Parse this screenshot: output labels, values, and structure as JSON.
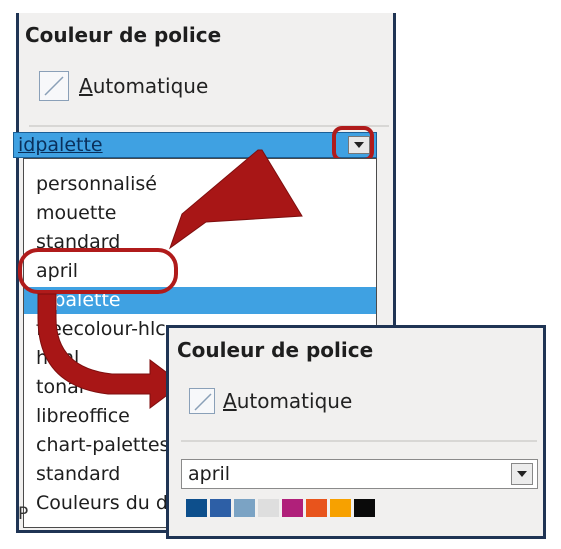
{
  "panel_back": {
    "title": "Couleur de police",
    "automatic_label_first": "A",
    "automatic_label_rest": "utomatique",
    "palette_selected": "idpalette",
    "palette_options": [
      "personnalisé",
      "mouette",
      "standard",
      "april",
      "idpalette",
      "freecolour-hlc",
      "html",
      "tonal",
      "libreoffice",
      "chart-palettes",
      "standard",
      "Couleurs du document"
    ],
    "highlighted_option": "idpalette",
    "bottom_fragment": "P"
  },
  "panel_front": {
    "title": "Couleur de police",
    "automatic_label_first": "A",
    "automatic_label_rest": "utomatique",
    "palette_selected": "april",
    "swatch_colors": [
      "#0d4f8c",
      "#2d5fa6",
      "#7ba3c4",
      "#dedede",
      "#b0207a",
      "#e8541c",
      "#f7a100",
      "#0a0a0a"
    ]
  },
  "annotation": {
    "color": "#b01b1b"
  }
}
